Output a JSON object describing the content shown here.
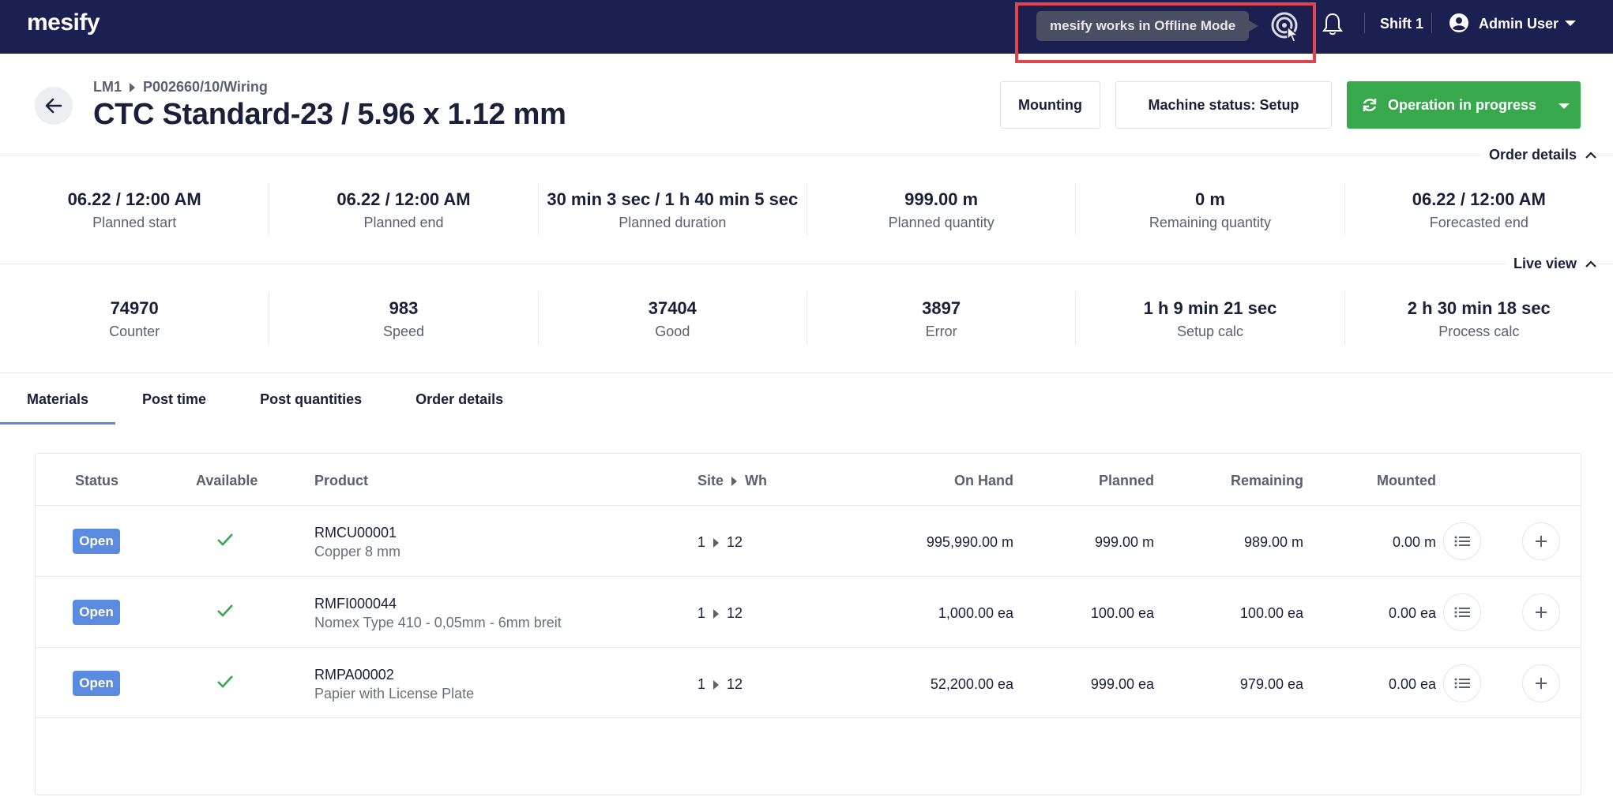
{
  "app": {
    "logo": "mesify",
    "offline_tooltip": "mesify works in Offline Mode",
    "shift": "Shift 1",
    "user": "Admin User"
  },
  "header": {
    "breadcrumb": [
      "LM1",
      "P002660/10/Wiring"
    ],
    "title": "CTC Standard-23 / 5.96 x 1.12 mm",
    "mounting_label": "Mounting",
    "machine_status_label": "Machine status: Setup",
    "operation_label": "Operation in progress"
  },
  "order_details": {
    "toggle_label": "Order details",
    "stats": [
      {
        "value": "06.22 / 12:00 AM",
        "label": "Planned start"
      },
      {
        "value": "06.22 / 12:00 AM",
        "label": "Planned end"
      },
      {
        "value": "30 min 3 sec / 1 h 40 min 5 sec",
        "label": "Planned duration"
      },
      {
        "value": "999.00 m",
        "label": "Planned quantity"
      },
      {
        "value": "0 m",
        "label": "Remaining quantity"
      },
      {
        "value": "06.22 / 12:00 AM",
        "label": "Forecasted end"
      }
    ]
  },
  "live_view": {
    "toggle_label": "Live view",
    "stats": [
      {
        "value": "74970",
        "label": "Counter"
      },
      {
        "value": "983",
        "label": "Speed"
      },
      {
        "value": "37404",
        "label": "Good"
      },
      {
        "value": "3897",
        "label": "Error"
      },
      {
        "value": "1 h 9 min 21 sec",
        "label": "Setup calc"
      },
      {
        "value": "2 h 30 min 18 sec",
        "label": "Process calc"
      }
    ]
  },
  "tabs": [
    "Materials",
    "Post time",
    "Post quantities",
    "Order details"
  ],
  "table": {
    "headers": {
      "status": "Status",
      "available": "Available",
      "product": "Product",
      "site": "Site",
      "wh": "Wh",
      "on_hand": "On Hand",
      "planned": "Planned",
      "remaining": "Remaining",
      "mounted": "Mounted"
    },
    "rows": [
      {
        "status": "Open",
        "code": "RMCU00001",
        "name": "Copper 8 mm",
        "site": "1",
        "wh": "12",
        "on_hand": "995,990.00 m",
        "planned": "999.00 m",
        "remaining": "989.00 m",
        "mounted": "0.00 m"
      },
      {
        "status": "Open",
        "code": "RMFI000044",
        "name": "Nomex Type 410 - 0,05mm - 6mm breit",
        "site": "1",
        "wh": "12",
        "on_hand": "1,000.00 ea",
        "planned": "100.00 ea",
        "remaining": "100.00 ea",
        "mounted": "0.00 ea"
      },
      {
        "status": "Open",
        "code": "RMPA00002",
        "name": "Papier with License Plate",
        "site": "1",
        "wh": "12",
        "on_hand": "52,200.00 ea",
        "planned": "999.00 ea",
        "remaining": "979.00 ea",
        "mounted": "0.00 ea"
      }
    ]
  },
  "colors": {
    "topbar": "#1b2051",
    "accent_blue": "#5b8be0",
    "success_green": "#37a84c",
    "highlight_red": "#e0454f"
  },
  "icons": {
    "back": "arrow-left-icon",
    "offline": "offline-touch-icon",
    "bell": "bell-icon",
    "user": "user-circle-icon",
    "refresh": "refresh-icon",
    "check": "check-icon",
    "list": "list-icon",
    "plus": "plus-icon"
  }
}
